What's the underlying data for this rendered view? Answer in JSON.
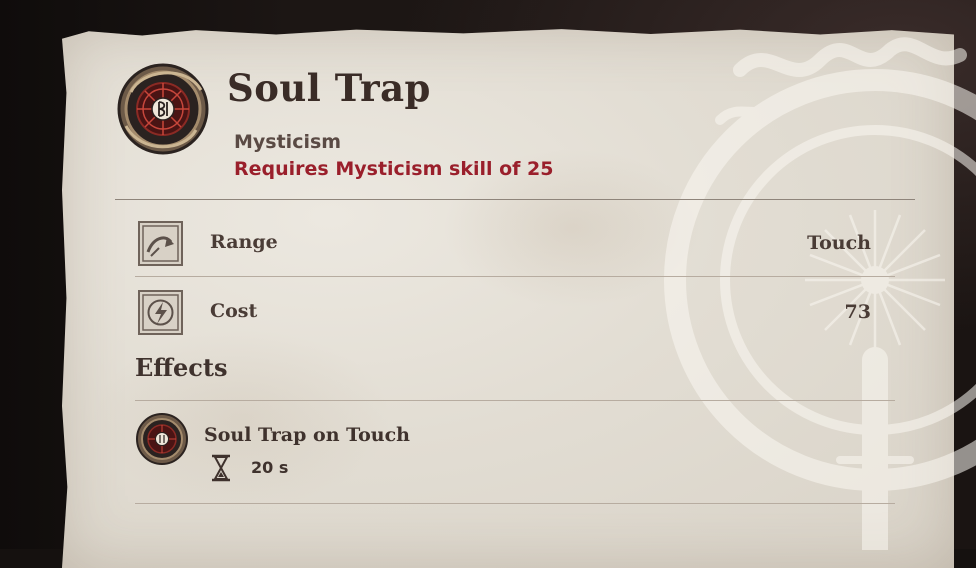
{
  "spell": {
    "name": "Soul Trap",
    "school": "Mysticism",
    "requirement": "Requires Mysticism skill of 25",
    "icon": "soul-trap-rune-icon"
  },
  "stats": [
    {
      "label": "Range",
      "value": "Touch",
      "icon": "range-arrow-icon"
    },
    {
      "label": "Cost",
      "value": "73",
      "icon": "magicka-bolt-icon"
    }
  ],
  "effects": {
    "heading": "Effects",
    "items": [
      {
        "name": "Soul Trap on Touch",
        "duration": "20 s",
        "icon": "soul-trap-rune-icon"
      }
    ]
  },
  "colors": {
    "requirement": "#9a1f2b",
    "text": "#3f322d",
    "parchment": "#e5e0d7"
  }
}
